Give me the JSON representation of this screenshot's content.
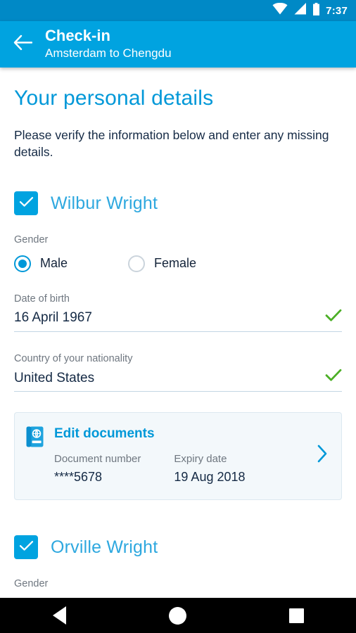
{
  "status_bar": {
    "time": "7:37",
    "icons": [
      "wifi-icon",
      "signal-icon",
      "battery-icon"
    ],
    "background": "#0089C6"
  },
  "app_bar": {
    "back_icon": "back-arrow-icon",
    "title": "Check-in",
    "subtitle": "Amsterdam to Chengdu",
    "background": "#00A3E0"
  },
  "page": {
    "title": "Your personal details",
    "description": "Please verify the information below and enter any missing details.",
    "title_color": "#0098D8",
    "text_color": "#152A45"
  },
  "passengers": [
    {
      "name": "Wilbur Wright",
      "selected": true,
      "gender": {
        "label": "Gender",
        "options": [
          {
            "label": "Male",
            "selected": true
          },
          {
            "label": "Female",
            "selected": false
          }
        ]
      },
      "fields": [
        {
          "label": "Date of birth",
          "value": "16 April 1967",
          "valid": true
        },
        {
          "label": "Country of your nationality",
          "value": "United States",
          "valid": true
        }
      ],
      "documents": {
        "icon": "passport-icon",
        "link_label": "Edit documents",
        "columns": [
          {
            "label": "Document number",
            "value": "****5678"
          },
          {
            "label": "Expiry date",
            "value": "19 Aug 2018"
          }
        ],
        "chevron": "chevron-right-icon"
      }
    },
    {
      "name": "Orville Wright",
      "selected": true,
      "gender": {
        "label": "Gender",
        "options": []
      },
      "fields": [],
      "documents": null
    }
  ],
  "nav_bar": {
    "back": "back-triangle-icon",
    "home": "home-circle-icon",
    "recents": "recents-square-icon"
  },
  "colors": {
    "accent": "#00A3E0",
    "accent_dark": "#0089C6",
    "link": "#0098D8",
    "valid_green": "#4CAF26",
    "muted": "#6F7780",
    "underline": "#C3D6E4",
    "card_bg": "#F3F8FB",
    "card_border": "#DCE8F0"
  }
}
